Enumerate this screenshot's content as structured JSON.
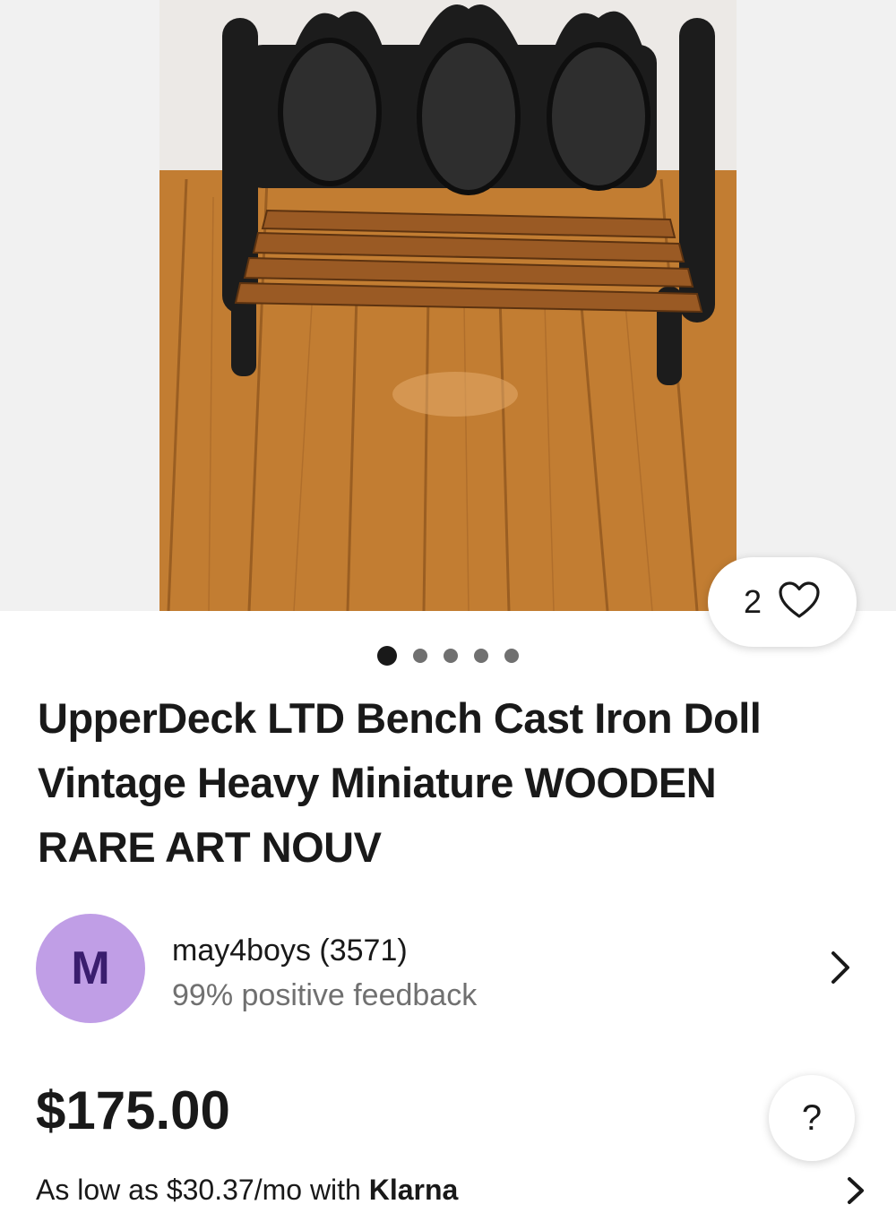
{
  "listing": {
    "favorites_count": "2",
    "carousel": {
      "total": 5,
      "active_index": 0
    },
    "title": "UpperDeck LTD Bench Cast Iron Doll Vintage Heavy Miniature WOODEN RARE ART NOUV",
    "price": "$175.00"
  },
  "seller": {
    "avatar_initial": "M",
    "name_line": "may4boys (3571)",
    "feedback": "99% positive feedback"
  },
  "financing": {
    "text": "As low as $30.37/mo with ",
    "brand": "Klarna"
  },
  "help": {
    "label": "?"
  },
  "icons": {
    "favorite": "heart-outline-icon",
    "seller_chevron": "chevron-right-icon",
    "financing_chevron": "chevron-right-icon"
  },
  "colors": {
    "avatar_bg": "#c09ee6",
    "avatar_text": "#3a1d6e",
    "text_primary": "#191919",
    "text_secondary": "#707070"
  }
}
